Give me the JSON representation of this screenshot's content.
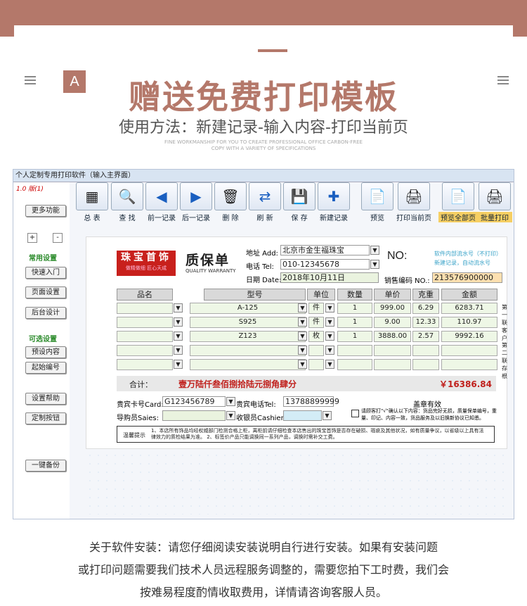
{
  "page": {
    "headline": "赠送免费打印模板",
    "subline": "使用方法：新建记录-输入内容-打印当前页",
    "tiny1": "FINE WORKMANSHIP FOR YOU TO CREATE PROFESSIONAL OFFICE CARBON-FREE",
    "tiny2": "COPY WITH A VARIETY OF SPECIFICATIONS",
    "badge": "A"
  },
  "software": {
    "title": "个人定制专用打印软件（输入主界面）",
    "record": "1.0 版(1)"
  },
  "left": {
    "more": "更多功能",
    "plus": "+",
    "minus": "-",
    "common": "常用设置",
    "btn1": "快速入门",
    "btn2": "页面设置",
    "btn3": "后台设计",
    "optional": "可选设置",
    "btn4": "预设内容",
    "btn5": "起始编号",
    "btn6": "设置帮助",
    "btn7": "定制按钮",
    "btn8": "一键备份"
  },
  "toolbar": [
    {
      "label": "总 表",
      "icon": "▦"
    },
    {
      "label": "查 找",
      "icon": "🔍"
    },
    {
      "label": "前一记录",
      "icon": "◀"
    },
    {
      "label": "后一记录",
      "icon": "▶"
    },
    {
      "label": "删 除",
      "icon": "🗑"
    },
    {
      "label": "刷 新",
      "icon": "⇄"
    },
    {
      "label": "保 存",
      "icon": "💾"
    },
    {
      "label": "新建记录",
      "icon": "✚"
    },
    {
      "label": "预览",
      "icon": "📄"
    },
    {
      "label": "打印当前页",
      "icon": "🖨"
    },
    {
      "label": "预览全部页",
      "icon": "📄"
    },
    {
      "label": "批量打印",
      "icon": "🖨"
    }
  ],
  "form": {
    "brand1": "珠宝首饰",
    "brand2": "做精做细 匠心天成",
    "title": "质保单",
    "subtitle": "QUALITY WARRANTY",
    "addr_label": "地址 Add:",
    "addr": "北京市金生福珠宝",
    "tel_label": "电话 Tel:",
    "tel": "010-12345678",
    "date_label": "日期 Date:",
    "date": "2018年10月11日",
    "no": "NO:",
    "sale_label": "销售编码 NO.:",
    "sale_no": "213576900000",
    "note1": "软件内部流水号（不打印）",
    "note2": "新建记录，自动流水号",
    "headers": [
      "品名",
      "型号",
      "单位",
      "数量",
      "单价",
      "克重",
      "金额"
    ],
    "rows": [
      {
        "name": "",
        "model": "A-125",
        "unit": "件",
        "qty": "1",
        "price": "999.00",
        "weight": "6.29",
        "amount": "6283.71"
      },
      {
        "name": "",
        "model": "S925",
        "unit": "件",
        "qty": "1",
        "price": "9.00",
        "weight": "12.33",
        "amount": "110.97"
      },
      {
        "name": "",
        "model": "Z123",
        "unit": "枚",
        "qty": "1",
        "price": "3888.00",
        "weight": "2.57",
        "amount": "9992.16"
      },
      {
        "name": "",
        "model": "",
        "unit": "",
        "qty": "",
        "price": "",
        "weight": "",
        "amount": ""
      },
      {
        "name": "",
        "model": "",
        "unit": "",
        "qty": "",
        "price": "",
        "weight": "",
        "amount": ""
      }
    ],
    "side1": "第一联客户",
    "side2": "第二联存根",
    "total_label": "合计：",
    "total_cn": "壹万陆仟叁佰捌拾陆元捌角肆分",
    "total_num": "￥16386.84",
    "card_label": "贵宾卡号Card:",
    "card": "G123456789",
    "vip_tel_label": "贵宾电话Tel:",
    "vip_tel": "13788899999",
    "valid": "盖章有效",
    "guide_label": "导购员Saies:",
    "cashier_label": "收银员Cashier:",
    "confirm": "请顾客打\"√\"确认以下内容：货品完好无损，质量保单编号，重量、印记、内容一致，货品服务及以旧换新协议已知悉。",
    "notice_label": "温馨提示",
    "notice": "1、本店所有饰品均经权威部门检测合格上柜，离柜前请仔细检查本店售出的珠宝首饰是否存在破损、瑕疵及其他状况，如有质量争议，以省级以上具有法律效力的质检结果为准。 2、标签价产品只能调换同一系列产品，调换时需补交工费。"
  },
  "caption": {
    "l1": "关于软件安装：请您仔细阅读安装说明自行进行安装。如果有安装问题",
    "l2": "或打印问题需要我们技术人员远程服务调整的，需要您拍下工时费，我们会",
    "l3": "按难易程度酌情收取费用，详情请咨询客服人员。"
  },
  "colors": {
    "accent": "#b4786a",
    "red": "#c0201c",
    "green": "#2a8a2a"
  }
}
